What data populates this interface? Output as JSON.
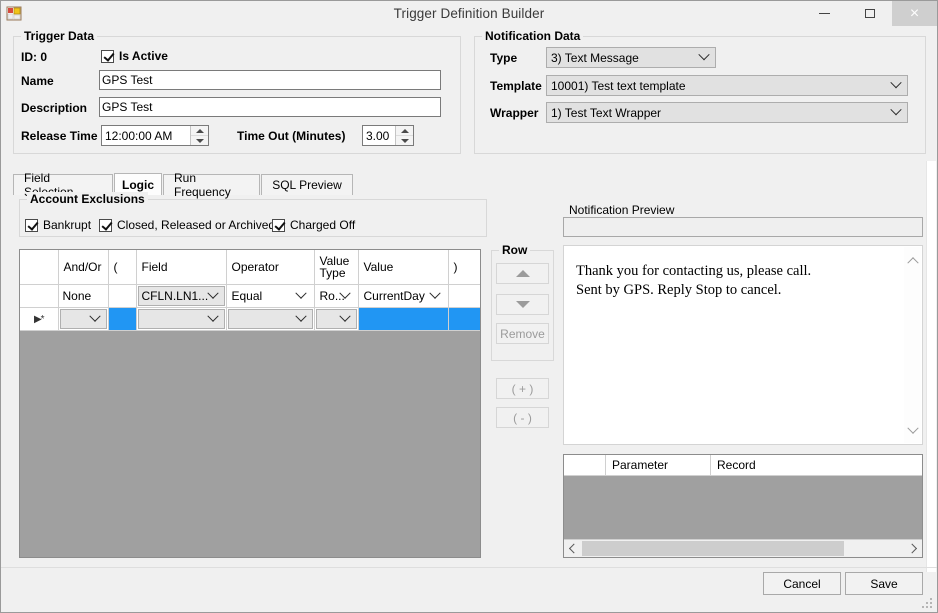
{
  "window": {
    "title": "Trigger Definition Builder",
    "icon": "form-designer-icon",
    "minimize_label": "Minimize",
    "maximize_label": "Maximize",
    "close_label": "×"
  },
  "trigger_data": {
    "group_title": "Trigger Data",
    "id_label": "ID: 0",
    "is_active_label": "Is Active",
    "is_active_checked": true,
    "name_label": "Name",
    "name_value": "GPS Test",
    "description_label": "Description",
    "description_value": "GPS Test",
    "release_time_label": "Release Time",
    "release_time_value": "12:00:00 AM",
    "time_out_label": "Time Out (Minutes)",
    "time_out_value": "3.00"
  },
  "notification_data": {
    "group_title": "Notification Data",
    "type_label": "Type",
    "type_value": "3) Text Message",
    "template_label": "Template",
    "template_value": "10001) Test text template",
    "wrapper_label": "Wrapper",
    "wrapper_value": "1) Test Text Wrapper"
  },
  "tabs": [
    {
      "label": "Field Selection",
      "active": false
    },
    {
      "label": "Logic",
      "active": true
    },
    {
      "label": "Run Frequency",
      "active": false
    },
    {
      "label": "SQL Preview",
      "active": false
    }
  ],
  "account_exclusions": {
    "group_title": "Account Exclusions",
    "options": [
      {
        "label": "Bankrupt",
        "checked": true
      },
      {
        "label": "Closed, Released or Archived",
        "checked": true
      },
      {
        "label": "Charged Off",
        "checked": true
      }
    ]
  },
  "logic_grid": {
    "columns": [
      "",
      "And/Or",
      "(",
      "Field",
      "Operator",
      "Value\nType",
      "Value",
      ")"
    ],
    "column_headers": {
      "andor": "And/Or",
      "open_paren": "(",
      "field": "Field",
      "operator": "Operator",
      "value_type": "Value Type",
      "value": "Value",
      "close_paren": ")"
    },
    "rows": [
      {
        "selector": "",
        "andor": "None",
        "open_paren": "",
        "field": "CFLN.LN1...",
        "operator": "Equal",
        "value_type": "Ro...",
        "value": "CurrentDay",
        "close_paren": ""
      },
      {
        "selector": "▶*",
        "andor": "",
        "open_paren": "",
        "field": "",
        "operator": "",
        "value_type": "",
        "value": "",
        "close_paren": ""
      }
    ]
  },
  "row_panel": {
    "group_title": "Row",
    "move_up_label": "",
    "move_down_label": "",
    "remove_label": "Remove",
    "add_group_label": "( + )",
    "remove_group_label": "( - )"
  },
  "notification_preview": {
    "group_title": "Notification Preview",
    "subject_value": "",
    "body_text": "Thank you for contacting us, please call.\nSent by GPS. Reply Stop to cancel."
  },
  "parameter_grid": {
    "columns": [
      "",
      "Parameter",
      "Record"
    ],
    "rows": []
  },
  "footer": {
    "cancel_label": "Cancel",
    "save_label": "Save"
  },
  "colors": {
    "selection_blue": "#2196f3",
    "grid_background": "#a0a0a0",
    "window_chrome": "#f0f0f0"
  }
}
